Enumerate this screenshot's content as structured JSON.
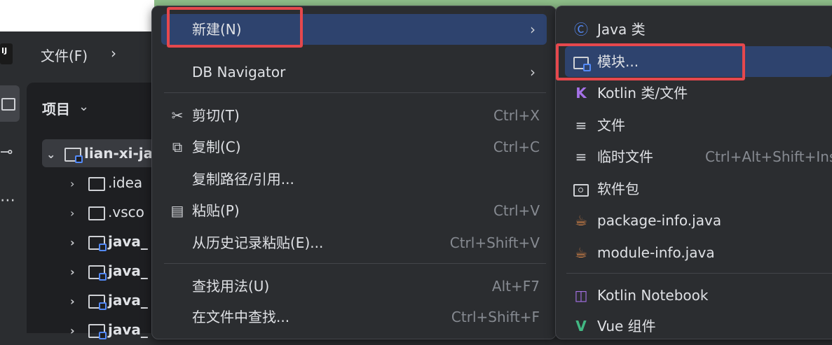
{
  "colors": {
    "accent": "#2e436e",
    "highlight_box": "#e5484d",
    "bg_green": "#8fbf8a"
  },
  "toolbar": {
    "file_menu": "文件(F)",
    "chevron": "›"
  },
  "project": {
    "title": "项目",
    "title_chevron": "⌄",
    "tree": [
      {
        "label": "lian-xi-ja",
        "expanded": true,
        "selected": true
      },
      {
        "label": ".idea"
      },
      {
        "label": ".vsco"
      },
      {
        "label": "java_"
      },
      {
        "label": "java_"
      },
      {
        "label": "java_"
      },
      {
        "label": "java_"
      }
    ]
  },
  "context_menu": {
    "items": [
      {
        "label": "新建(N)",
        "submenu": true,
        "highlighted": true
      },
      {
        "label": "DB Navigator",
        "submenu": true
      },
      {
        "label": "剪切(T)",
        "shortcut": "Ctrl+X",
        "icon": "scissors-icon"
      },
      {
        "label": "复制(C)",
        "shortcut": "Ctrl+C",
        "icon": "copy-icon"
      },
      {
        "label": "复制路径/引用..."
      },
      {
        "label": "粘贴(P)",
        "shortcut": "Ctrl+V",
        "icon": "clipboard-icon"
      },
      {
        "label": "从历史记录粘贴(E)...",
        "shortcut": "Ctrl+Shift+V"
      },
      {
        "label": "查找用法(U)",
        "shortcut": "Alt+F7"
      },
      {
        "label": "在文件中查找...",
        "shortcut": "Ctrl+Shift+F"
      }
    ]
  },
  "new_submenu": {
    "items": [
      {
        "label": "Java 类",
        "icon": "java-class-icon"
      },
      {
        "label": "模块...",
        "icon": "module-icon",
        "highlighted": true
      },
      {
        "label": "Kotlin 类/文件",
        "icon": "kotlin-icon"
      },
      {
        "label": "文件",
        "icon": "file-icon"
      },
      {
        "label": "临时文件",
        "shortcut": "Ctrl+Alt+Shift+Ins",
        "icon": "scratch-file-icon"
      },
      {
        "label": "软件包",
        "icon": "package-icon"
      },
      {
        "label": "package-info.java",
        "icon": "java-cup-icon"
      },
      {
        "label": "module-info.java",
        "icon": "java-cup-icon"
      },
      {
        "label": "Kotlin Notebook",
        "icon": "kotlin-notebook-icon"
      },
      {
        "label": "Vue 组件",
        "icon": "vue-icon"
      }
    ]
  }
}
